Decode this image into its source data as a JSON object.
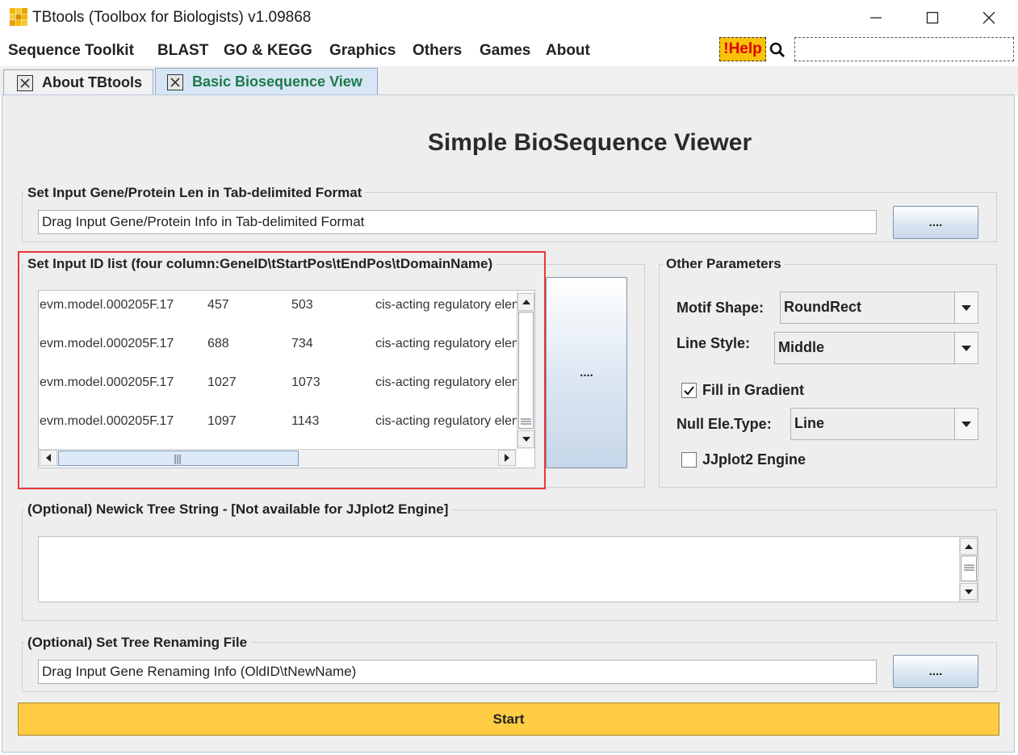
{
  "window": {
    "title": "TBtools (Toolbox for Biologists) v1.09868"
  },
  "menu": {
    "items": [
      "Sequence Toolkit",
      "BLAST",
      "GO & KEGG",
      "Graphics",
      "Others",
      "Games",
      "About"
    ],
    "help_label": "!Help",
    "search_value": ""
  },
  "tabs": [
    {
      "label": "About TBtools",
      "active": false
    },
    {
      "label": "Basic Biosequence View",
      "active": true
    }
  ],
  "main": {
    "title": "Simple BioSequence Viewer"
  },
  "gene_len": {
    "group_title": "Set Input Gene/Protein Len in Tab-delimited Format",
    "field_value": "Drag Input Gene/Protein Info in Tab-delimited Format",
    "button_label": "...."
  },
  "id_list": {
    "group_title": "Set Input ID list (four column:GeneID\\tStartPos\\tEndPos\\tDomainName)",
    "button_label": "....",
    "rows": [
      [
        "evm.model.000205F.17",
        "457",
        "503",
        "cis-acting regulatory elem"
      ],
      [
        "evm.model.000205F.17",
        "688",
        "734",
        "cis-acting regulatory elem"
      ],
      [
        "evm.model.000205F.17",
        "1027",
        "1073",
        "cis-acting regulatory elem"
      ],
      [
        "evm.model.000205F.17",
        "1097",
        "1143",
        "cis-acting regulatory elem"
      ]
    ]
  },
  "params": {
    "group_title": "Other Parameters",
    "motif_shape_label": "Motif Shape:",
    "motif_shape_value": "RoundRect",
    "line_style_label": "Line Style:",
    "line_style_value": "Middle",
    "fill_gradient_label": "Fill in Gradient",
    "fill_gradient_checked": true,
    "null_ele_label": "Null Ele.Type:",
    "null_ele_value": "Line",
    "jjplot_label": "JJplot2 Engine",
    "jjplot_checked": false
  },
  "newick": {
    "group_title": "(Optional) Newick Tree String - [Not available for JJplot2 Engine]",
    "value": ""
  },
  "rename": {
    "group_title": "(Optional) Set Tree Renaming File",
    "field_value": "Drag Input Gene Renaming Info (OldID\\tNewName)",
    "button_label": "...."
  },
  "start_label": "Start",
  "colors": {
    "accent_yellow": "#ffcc44",
    "help_bg": "#f8c20a",
    "help_text": "#e00000",
    "highlight": "#e53a3a",
    "active_tab_text": "#1e7a4a"
  }
}
